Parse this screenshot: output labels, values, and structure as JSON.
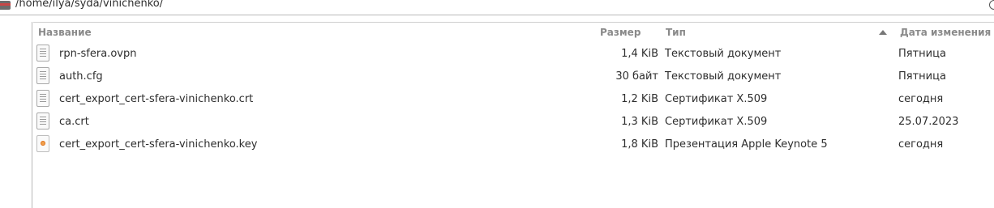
{
  "location": {
    "path": "/home/ilya/syda/vinichenko/"
  },
  "columns": {
    "name": "Название",
    "size": "Размер",
    "type": "Тип",
    "date": "Дата изменения"
  },
  "files": [
    {
      "name": "rpn-sfera.ovpn",
      "size": "1,4 KiB",
      "type": "Текстовый документ",
      "date": "Пятница",
      "icon": "text-file-icon"
    },
    {
      "name": "auth.cfg",
      "size": "30 байт",
      "type": "Текстовый документ",
      "date": "Пятница",
      "icon": "text-file-icon"
    },
    {
      "name": "cert_export_cert-sfera-vinichenko.crt",
      "size": "1,2 KiB",
      "type": "Сертификат X.509",
      "date": "сегодня",
      "icon": "text-file-icon"
    },
    {
      "name": "ca.crt",
      "size": "1,3 KiB",
      "type": "Сертификат X.509",
      "date": "25.07.2023",
      "icon": "text-file-icon"
    },
    {
      "name": "cert_export_cert-sfera-vinichenko.key",
      "size": "1,8 KiB",
      "type": "Презентация Apple Keynote 5",
      "date": "сегодня",
      "icon": "keynote-file-icon"
    }
  ]
}
